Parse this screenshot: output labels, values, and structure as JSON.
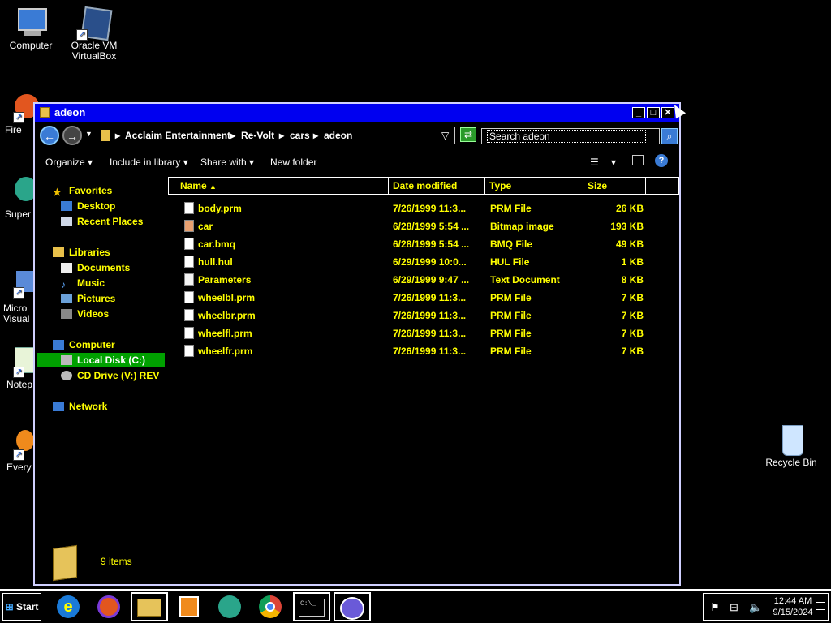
{
  "desktop": {
    "icons": [
      {
        "label": "Computer"
      },
      {
        "label": "Oracle VM VirtualBox"
      },
      {
        "label": "Recycle Bin"
      },
      {
        "label": "Fire"
      },
      {
        "label": "Super"
      },
      {
        "label": "Micro Visual"
      },
      {
        "label": "Notep"
      },
      {
        "label": "Every"
      }
    ]
  },
  "window": {
    "title": "adeon",
    "address": {
      "crumbs": [
        "Acclaim Entertainment",
        "Re-Volt",
        "cars",
        "adeon"
      ]
    },
    "search": {
      "placeholder": "Search adeon"
    },
    "toolbar": {
      "organize": "Organize",
      "include_in_library": "Include in library",
      "share_with": "Share with",
      "new_folder": "New folder"
    },
    "nav": {
      "favorites": "Favorites",
      "desktop": "Desktop",
      "recent_places": "Recent Places",
      "libraries": "Libraries",
      "documents": "Documents",
      "music": "Music",
      "pictures": "Pictures",
      "videos": "Videos",
      "computer": "Computer",
      "local_disk": "Local Disk (C:)",
      "cd_drive": "CD Drive (V:) REV",
      "network": "Network"
    },
    "columns": {
      "name": "Name",
      "date_modified": "Date modified",
      "type": "Type",
      "size": "Size"
    },
    "files": [
      {
        "name": "body.prm",
        "date": "7/26/1999 11:3...",
        "type": "PRM File",
        "size": "26 KB",
        "icon": "file-icon"
      },
      {
        "name": "car",
        "date": "6/28/1999 5:54 ...",
        "type": "Bitmap image",
        "size": "193 KB",
        "icon": "bitmap-icon"
      },
      {
        "name": "car.bmq",
        "date": "6/28/1999 5:54 ...",
        "type": "BMQ File",
        "size": "49 KB",
        "icon": "file-icon"
      },
      {
        "name": "hull.hul",
        "date": "6/29/1999 10:0...",
        "type": "HUL File",
        "size": "1 KB",
        "icon": "file-icon"
      },
      {
        "name": "Parameters",
        "date": "6/29/1999 9:47 ...",
        "type": "Text Document",
        "size": "8 KB",
        "icon": "text-file-icon"
      },
      {
        "name": "wheelbl.prm",
        "date": "7/26/1999 11:3...",
        "type": "PRM File",
        "size": "7 KB",
        "icon": "file-icon"
      },
      {
        "name": "wheelbr.prm",
        "date": "7/26/1999 11:3...",
        "type": "PRM File",
        "size": "7 KB",
        "icon": "file-icon"
      },
      {
        "name": "wheelfl.prm",
        "date": "7/26/1999 11:3...",
        "type": "PRM File",
        "size": "7 KB",
        "icon": "file-icon"
      },
      {
        "name": "wheelfr.prm",
        "date": "7/26/1999 11:3...",
        "type": "PRM File",
        "size": "7 KB",
        "icon": "file-icon"
      }
    ],
    "status": "9 items"
  },
  "taskbar": {
    "start": "Start",
    "clock_time": "12:44 AM",
    "clock_date": "9/15/2024"
  },
  "colors": {
    "titlebar": "#0000f0",
    "text_highlight": "#ffff00",
    "selection": "#00a000",
    "background": "#000000"
  }
}
